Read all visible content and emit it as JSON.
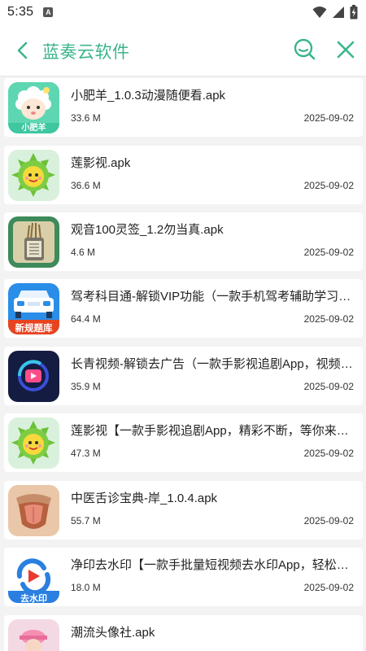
{
  "status_bar": {
    "time": "5:35",
    "notification_badge": "A"
  },
  "header": {
    "title": "蓝奏云软件",
    "accent_color": "#3bb48c"
  },
  "files": [
    {
      "name": "小肥羊_1.0.3动漫随便看.apk",
      "size": "33.6 M",
      "date": "2025-09-02",
      "icon": "sheep-app-icon",
      "icon_text": "小肥羊"
    },
    {
      "name": "莲影视.apk",
      "size": "36.6 M",
      "date": "2025-09-02",
      "icon": "durian-app-icon"
    },
    {
      "name": "观音100灵签_1.2勿当真.apk",
      "size": "4.6 M",
      "date": "2025-09-02",
      "icon": "fortune-sticks-app-icon"
    },
    {
      "name": "驾考科目通-解锁VIP功能（一款手机驾考辅助学习工具",
      "size": "64.4 M",
      "date": "2025-09-02",
      "icon": "car-app-icon",
      "icon_text": "新规题库"
    },
    {
      "name": "长青视频-解锁去广告（一款手影视追剧App，视频世界任你畅游",
      "size": "35.9 M",
      "date": "2025-09-02",
      "icon": "play-app-icon"
    },
    {
      "name": "莲影视【一款手影视追剧App，精彩不断，等你来瞧！】",
      "size": "47.3 M",
      "date": "2025-09-02",
      "icon": "durian-app-icon"
    },
    {
      "name": "中医舌诊宝典-岸_1.0.4.apk",
      "size": "55.7 M",
      "date": "2025-09-02",
      "icon": "tongue-app-icon"
    },
    {
      "name": "净印去水印【一款手批量短视频去水印App，轻松去除水印】",
      "size": "18.0 M",
      "date": "2025-09-02",
      "icon": "watermark-app-icon",
      "icon_text": "去水印"
    },
    {
      "name": "潮流头像社.apk",
      "size": "",
      "date": "",
      "icon": "avatar-app-icon"
    }
  ]
}
